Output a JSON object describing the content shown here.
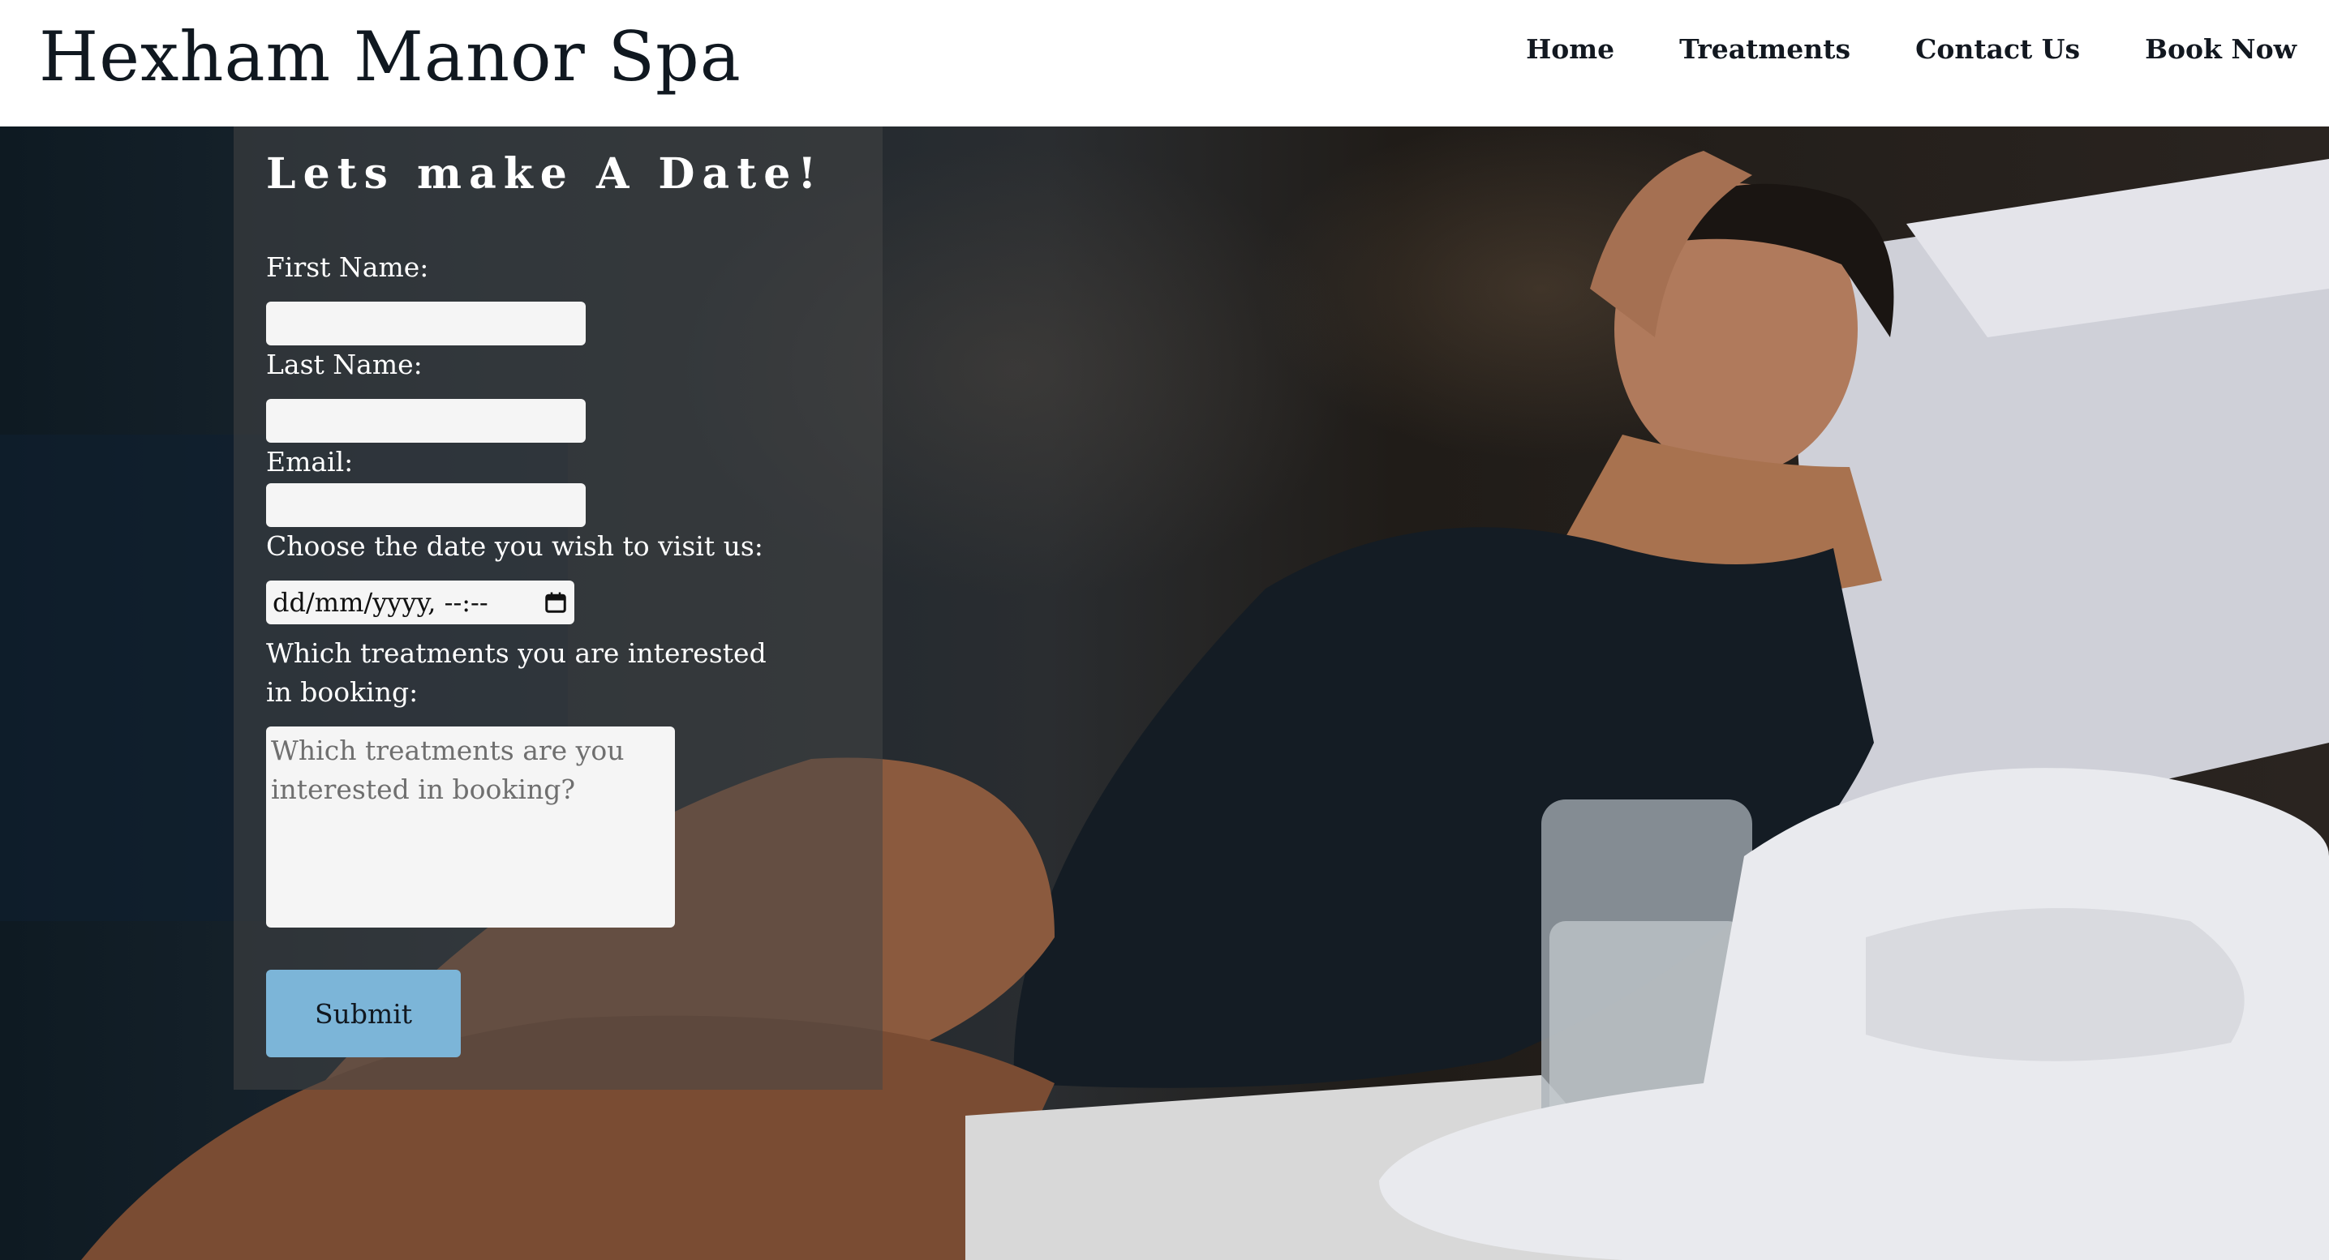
{
  "site": {
    "title": "Hexham Manor Spa"
  },
  "nav": {
    "items": [
      "Home",
      "Treatments",
      "Contact Us",
      "Book Now"
    ]
  },
  "form": {
    "title": "Lets make A Date!",
    "first_name_label": "First Name:",
    "last_name_label": "Last Name:",
    "email_label": "Email:",
    "date_label": "Choose the date you wish to visit us:",
    "date_value": "dd/mm/yyyy, --:--",
    "treatments_label": "Which treatments you are interested in booking:",
    "treatments_placeholder": "Which treatments are you interested in booking?",
    "submit_label": "Submit"
  },
  "colors": {
    "header_bg": "#ffffff",
    "submit_bg": "#7cb5d8",
    "panel_bg": "rgba(70,70,70,0.55)"
  },
  "hero": {
    "icon": "spa-woman-relaxing-image"
  }
}
